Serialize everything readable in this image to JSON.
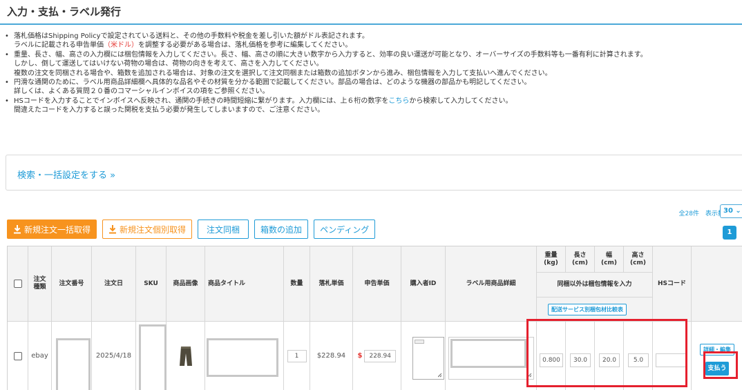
{
  "page": {
    "title": "入力・支払・ラベル発行"
  },
  "notes": [
    {
      "lines": [
        "落札価格はShipping Policyで設定されている送料と、その他の手数料や税金を差し引いた額がドル表記されます。"
      ],
      "line2_prefix": "ラベルに記載される申告単価",
      "line2_red": "（米ドル）",
      "line2_suffix": "を調整する必要がある場合は、落札価格を参考に編集してください。"
    },
    {
      "lines": [
        "重量、長さ、幅、高さの入力欄には梱包情報を入力してください。長さ、幅、高さの順に大きい数字から入力すると、効率の良い運送が可能となり、オーバーサイズの手数料等も一番有利に計算されます。",
        "しかし、倒して運送してはいけない荷物の場合は、荷物の向きを考えて、高さを入力してください。",
        "複数の注文を同梱される場合や、箱数を追加される場合は、対象の注文を選択して注文同梱または箱数の追加ボタンから進み、梱包情報を入力して支払いへ進んでください。"
      ]
    },
    {
      "lines": [
        "円滑な通関のために、ラベル用商品詳細欄へ具体的な品名やその材質を分かる範囲で記載してください。部品の場合は、どのような機器の部品かも明記してください。",
        "詳しくは、よくある質問２０番のコマーシャルインボイスの項をご参照ください。"
      ]
    },
    {
      "line1_prefix": "HSコードを入力することでインボイスへ反映され、通関の手続きの時間短縮に繋がります。入力欄には、上６桁の数字を",
      "line1_link": "こちら",
      "line1_suffix": "から検索して入力してください。",
      "lines": [
        "間違えたコードを入力すると誤った関税を支払う必要が発生してしまいますので、ご注意ください。"
      ]
    }
  ],
  "bullet": "•",
  "search": {
    "link_label": "検索・一括設定をする »"
  },
  "pagination": {
    "summary": "全28件　表示数",
    "per_page": "30",
    "current_page": "1"
  },
  "toolbar": {
    "bulk_fetch_label": "新規注文一括取得",
    "single_fetch_label": "新規注文個別取得",
    "merge_label": "注文同梱",
    "add_box_label": "箱数の追加",
    "pending_label": "ペンディング"
  },
  "table": {
    "headers": {
      "order_type": "注文\n種類",
      "order_number": "注文番号",
      "order_date": "注文日",
      "sku": "SKU",
      "image": "商品画像",
      "title": "商品タイトル",
      "quantity": "数量",
      "price": "落札単価",
      "declared": "申告単価",
      "buyer_id": "購入者ID",
      "label_detail": "ラベル用商品詳細",
      "weight": "重量\n(kg)",
      "length": "長さ\n(cm)",
      "width": "幅\n(cm)",
      "height": "高さ\n(cm)",
      "package_note": "同梱以外は梱包情報を入力",
      "compare_button": "配送サービス別梱包材比較表",
      "hs_code": "HSコード"
    },
    "row": {
      "order_type": "ebay",
      "order_date": "2025/4/18",
      "quantity": "1",
      "price": "$228.94",
      "currency": "$",
      "declared": "228.94",
      "weight": "0.800",
      "length": "30.0",
      "width": "20.0",
      "height": "5.0",
      "detail_edit_label": "詳細・編集",
      "pay_label": "支払う"
    }
  },
  "colors": {
    "accent": "#1e9bd7",
    "orange": "#f7931e",
    "highlight": "#e5202e"
  }
}
